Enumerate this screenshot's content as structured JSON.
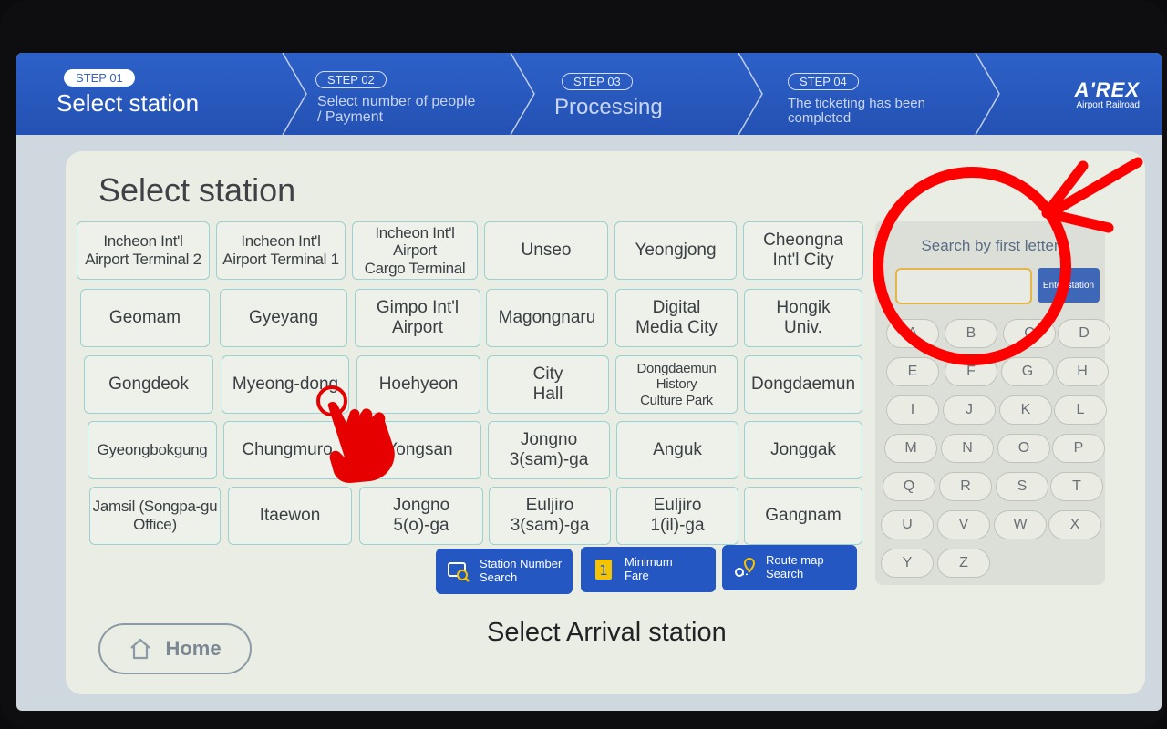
{
  "steps": [
    {
      "badge": "STEP 01",
      "title": "Select station"
    },
    {
      "badge": "STEP 02",
      "title": "Select number of people\n/ Payment"
    },
    {
      "badge": "STEP 03",
      "title": "Processing"
    },
    {
      "badge": "STEP 04",
      "title": "The ticketing has been\ncompleted"
    }
  ],
  "brand": {
    "name": "A'REX",
    "subtitle": "Airport Railroad"
  },
  "page_title": "Select station",
  "stations": [
    "Incheon Int'l\nAirport Terminal 2",
    "Incheon Int'l\nAirport Terminal 1",
    "Incheon Int'l Airport\nCargo Terminal",
    "Unseo",
    "Yeongjong",
    "Cheongna\nInt'l City",
    "Geomam",
    "Gyeyang",
    "Gimpo Int'l\nAirport",
    "Magongnaru",
    "Digital\nMedia City",
    "Hongik\nUniv.",
    "Gongdeok",
    "Myeong-dong",
    "Hoehyeon",
    "City\nHall",
    "Dongdaemun History\nCulture Park",
    "Dongdaemun",
    "Gyeongbokgung",
    "Chungmuro",
    "Yongsan",
    "Jongno\n3(sam)-ga",
    "Anguk",
    "Jonggak",
    "Jamsil (Songpa-gu\nOffice)",
    "Itaewon",
    "Jongno\n5(o)-ga",
    "Euljiro\n3(sam)-ga",
    "Euljiro\n1(il)-ga",
    "Gangnam"
  ],
  "function_buttons": [
    {
      "label": "Station Number\nSearch",
      "icon": "station-number-search-icon"
    },
    {
      "label": "Minimum\nFare",
      "icon": "minimum-fare-icon"
    },
    {
      "label": "Route map\nSearch",
      "icon": "route-map-icon"
    }
  ],
  "arrival_prompt": "Select Arrival station",
  "home_label": "Home",
  "letter_search": {
    "title": "Search by first letter",
    "input_value": "",
    "enter_label": "Enter station",
    "letters": [
      "A",
      "B",
      "C",
      "D",
      "E",
      "F",
      "G",
      "H",
      "I",
      "J",
      "K",
      "L",
      "M",
      "N",
      "O",
      "P",
      "Q",
      "R",
      "S",
      "T",
      "U",
      "V",
      "W",
      "X",
      "Y",
      "Z"
    ]
  },
  "colors": {
    "header_blue": "#2457c2",
    "station_border": "#9ad1d2",
    "annotation_red": "#ff0000",
    "input_border": "#e3b54a"
  }
}
